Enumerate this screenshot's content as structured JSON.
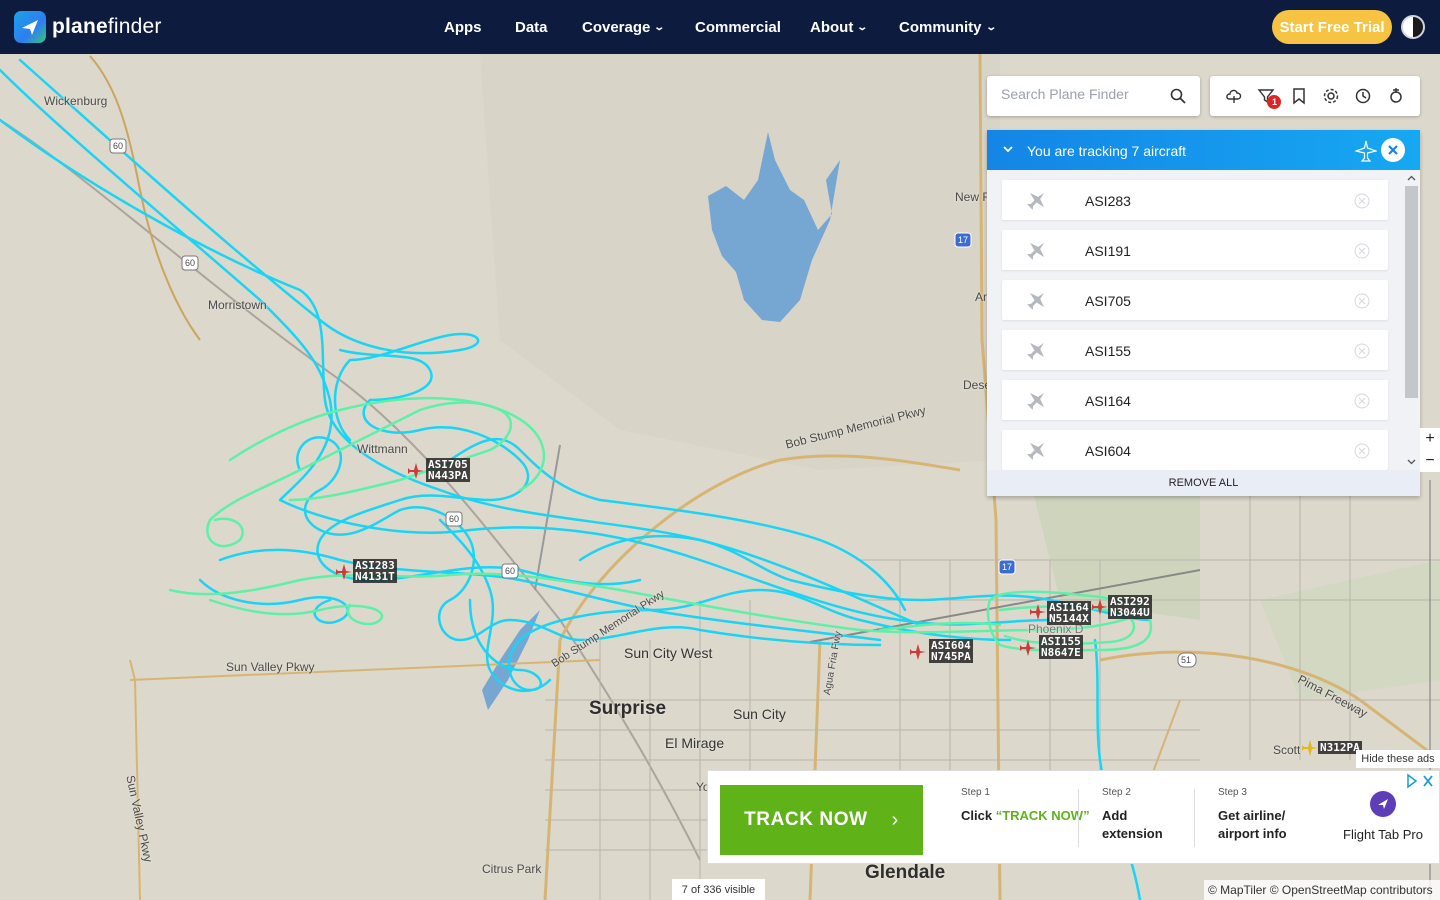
{
  "header": {
    "brand_bold": "plane",
    "brand_rest": "finder",
    "nav": [
      {
        "label": "Apps",
        "has_dropdown": false
      },
      {
        "label": "Data",
        "has_dropdown": false
      },
      {
        "label": "Coverage",
        "has_dropdown": true
      },
      {
        "label": "Commercial",
        "has_dropdown": false
      },
      {
        "label": "About",
        "has_dropdown": true
      },
      {
        "label": "Community",
        "has_dropdown": true
      }
    ],
    "trial_button": "Start Free Trial"
  },
  "search": {
    "placeholder": "Search Plane Finder"
  },
  "toolbar": {
    "icons": [
      "cloud-icon",
      "filter-icon",
      "bookmark-icon",
      "settings-icon",
      "history-icon",
      "ar-icon"
    ],
    "filter_badge": "1"
  },
  "tracking": {
    "title": "You are tracking 7 aircraft",
    "aircraft": [
      "ASI283",
      "ASI191",
      "ASI705",
      "ASI155",
      "ASI164",
      "ASI604"
    ],
    "remove_all": "REMOVE ALL"
  },
  "zoom": {
    "in": "+",
    "out": "−"
  },
  "map": {
    "places": {
      "wickenburg": "Wickenburg",
      "morristown": "Morristown",
      "wittmann": "Wittmann",
      "new_river": "New R",
      "anthem": "An",
      "desert_hills": "Dese",
      "surprise": "Surprise",
      "sun_city": "Sun City",
      "sun_city_west": "Sun City West",
      "el_mirage": "El Mirage",
      "youngtown": "Yo",
      "citrus_park": "Citrus Park",
      "glendale": "Glendale",
      "phoenix_deer_valley": "Phoenix D",
      "scottsdale": "Scott",
      "sun_valley_pkwy": "Sun Valley Pkwy",
      "sun_valley_pkwy_v": "Sun Valley Pkwy",
      "bob_stump_pkwy": "Bob Stump Memorial Pkwy",
      "bob_stump_pkwy_2": "Bob Stump Memorial Pkwy",
      "pima_freeway": "Pima Freeway",
      "agua_fria": "Agua Fria Fwy",
      "route_60": "60",
      "route_60b": "60",
      "route_60c": "60",
      "route_60d": "60",
      "i17": "17",
      "i17b": "17",
      "route_51": "51"
    },
    "aircraft_labels": [
      {
        "callsign": "ASI705",
        "reg": "N443PA"
      },
      {
        "callsign": "ASI283",
        "reg": "N4131T"
      },
      {
        "callsign": "ASI604",
        "reg": "N745PA"
      },
      {
        "callsign": "ASI164",
        "reg": "N5144X"
      },
      {
        "callsign": "ASI155",
        "reg": "N8647E"
      },
      {
        "callsign": "ASI292",
        "reg": "N3044U"
      },
      {
        "callsign": "N312PA",
        "reg": ""
      }
    ],
    "track_colors": {
      "primary": "#19d3f5",
      "secondary": "#5ef0a8"
    }
  },
  "ad": {
    "hide_label": "Hide these ads",
    "cta": "TRACK NOW",
    "steps": [
      {
        "label": "Step 1",
        "text_pre": "Click ",
        "text_hl": "“TRACK NOW”"
      },
      {
        "label": "Step 2",
        "text": "Add extension"
      },
      {
        "label": "Step 3",
        "text": "Get airline/ airport info"
      }
    ],
    "brand": "Flight Tab Pro"
  },
  "footer": {
    "visible_count": "7 of 336 visible",
    "attribution": "© MapTiler © OpenStreetMap contributors"
  }
}
